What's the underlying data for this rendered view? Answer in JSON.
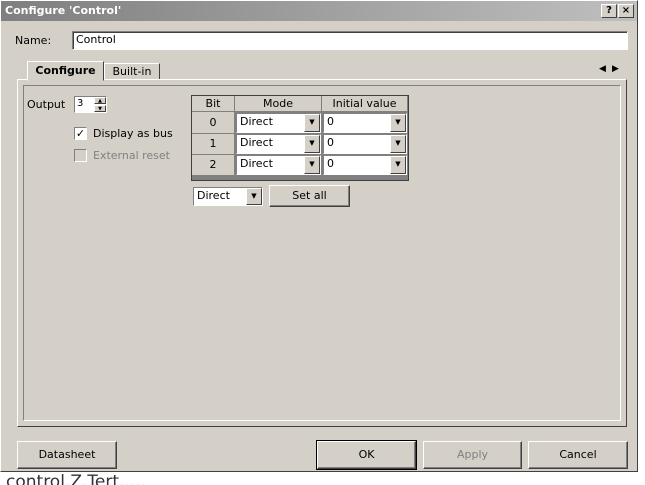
{
  "window": {
    "title": "Configure 'Control'",
    "help_glyph": "?",
    "close_glyph": "×"
  },
  "name": {
    "label": "Name:",
    "value": "Control"
  },
  "tabs": [
    {
      "label": "Configure",
      "selected": true
    },
    {
      "label": "Built-in",
      "selected": false
    }
  ],
  "tab_nav": {
    "prev_glyph": "◀",
    "next_glyph": "▶"
  },
  "config": {
    "output_label": "Output",
    "output_value": "3",
    "display_as_bus": {
      "label": "Display as bus",
      "checked": true,
      "enabled": true
    },
    "external_reset": {
      "label": "External reset",
      "checked": false,
      "enabled": false
    }
  },
  "bits_table": {
    "headers": [
      "Bit",
      "Mode",
      "Initial value"
    ],
    "rows": [
      {
        "bit": "0",
        "mode": "Direct",
        "initial": "0"
      },
      {
        "bit": "1",
        "mode": "Direct",
        "initial": "0"
      },
      {
        "bit": "2",
        "mode": "Direct",
        "initial": "0"
      }
    ]
  },
  "set_all": {
    "mode": "Direct",
    "button_label": "Set all"
  },
  "footer": {
    "datasheet": "Datasheet",
    "ok": "OK",
    "apply": "Apply",
    "cancel": "Cancel"
  },
  "background_text": "control.Z.Tert....."
}
